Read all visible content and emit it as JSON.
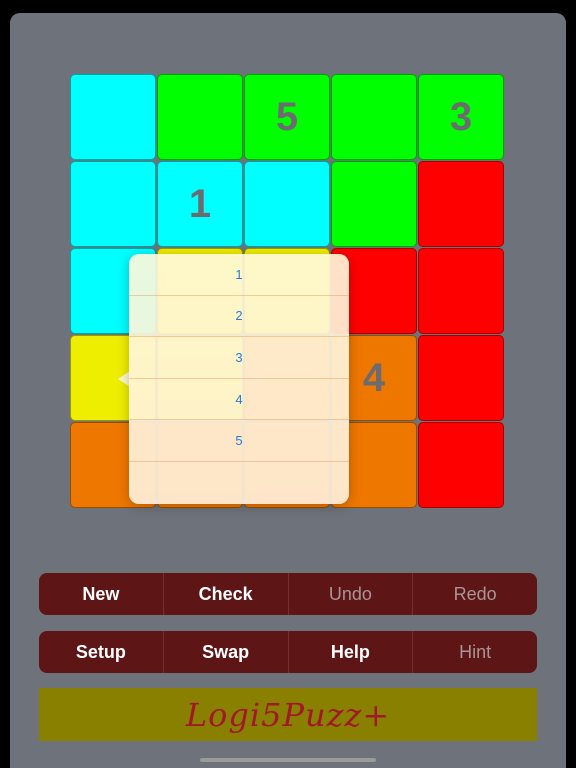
{
  "colors": {
    "cyan": "#00ffff",
    "green": "#00ff00",
    "red": "#ff0000",
    "yellow": "#eeee00",
    "orange": "#ee7700",
    "background": "#6e727a",
    "button_bg": "#5e1515",
    "banner_bg": "#8a8000",
    "banner_text": "#a0182a",
    "popover_text": "#2b79e0"
  },
  "grid": {
    "rows": [
      [
        {
          "color": "cyan",
          "label": ""
        },
        {
          "color": "green",
          "label": ""
        },
        {
          "color": "green",
          "label": "5"
        },
        {
          "color": "green",
          "label": ""
        },
        {
          "color": "green",
          "label": "3"
        }
      ],
      [
        {
          "color": "cyan",
          "label": ""
        },
        {
          "color": "cyan",
          "label": "1"
        },
        {
          "color": "cyan",
          "label": ""
        },
        {
          "color": "green",
          "label": ""
        },
        {
          "color": "red",
          "label": ""
        }
      ],
      [
        {
          "color": "cyan",
          "label": ""
        },
        {
          "color": "yellow",
          "label": ""
        },
        {
          "color": "yellow",
          "label": ""
        },
        {
          "color": "red",
          "label": ""
        },
        {
          "color": "red",
          "label": ""
        }
      ],
      [
        {
          "color": "yellow",
          "label": ""
        },
        {
          "color": "yellow",
          "label": ""
        },
        {
          "color": "orange",
          "label": ""
        },
        {
          "color": "orange",
          "label": "4"
        },
        {
          "color": "red",
          "label": ""
        }
      ],
      [
        {
          "color": "orange",
          "label": ""
        },
        {
          "color": "orange",
          "label": ""
        },
        {
          "color": "orange",
          "label": ""
        },
        {
          "color": "orange",
          "label": ""
        },
        {
          "color": "red",
          "label": ""
        }
      ]
    ]
  },
  "popover": {
    "options": [
      "1",
      "2",
      "3",
      "4",
      "5",
      ""
    ]
  },
  "toolbar": {
    "row1": {
      "new_label": "New",
      "check_label": "Check",
      "undo_label": "Undo",
      "redo_label": "Redo"
    },
    "row2": {
      "setup_label": "Setup",
      "swap_label": "Swap",
      "help_label": "Help",
      "hint_label": "Hint"
    }
  },
  "banner": {
    "title": "Logi5Puzz+"
  }
}
